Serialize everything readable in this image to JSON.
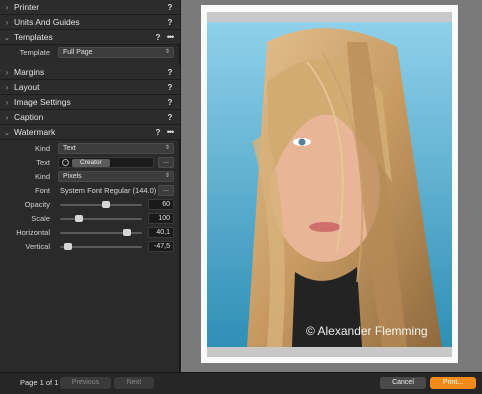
{
  "sections": {
    "printer": "Printer",
    "units": "Units And Guides",
    "templates": "Templates",
    "margins": "Margins",
    "layout": "Layout",
    "image_settings": "Image Settings",
    "caption": "Caption",
    "watermark": "Watermark"
  },
  "help_glyph": "?",
  "more_glyph": "•••",
  "collapsed_chevron": "›",
  "expanded_chevron": "⌄",
  "templates": {
    "label": "Template",
    "value": "Full Page"
  },
  "watermark": {
    "kind_label": "Kind",
    "kind_value": "Text",
    "text_label": "Text",
    "text_token": "Creator",
    "unit_label": "Kind",
    "unit_value": "Pixels",
    "font_label": "Font",
    "font_value": "System Font Regular (144.0)",
    "dots": "...",
    "opacity_label": "Opacity",
    "opacity_value": "60",
    "opacity_level": 0.57,
    "scale_label": "Scale",
    "scale_value": "100",
    "scale_level": 0.2,
    "horizontal_label": "Horizontal",
    "horizontal_value": "40,1",
    "horizontal_level": 0.85,
    "vertical_label": "Vertical",
    "vertical_value": "-47,5",
    "vertical_level": 0.05
  },
  "preview": {
    "watermark_text": "© Alexander Flemming"
  },
  "footer": {
    "page_count": "Page 1 of 1",
    "previous": "Previous",
    "next": "Next",
    "cancel": "Cancel",
    "print": "Print..."
  },
  "colors": {
    "accent": "#f28a1a",
    "panel": "#2a2a2a",
    "sky": "#6ab7d8",
    "hair": "#c79a62"
  }
}
